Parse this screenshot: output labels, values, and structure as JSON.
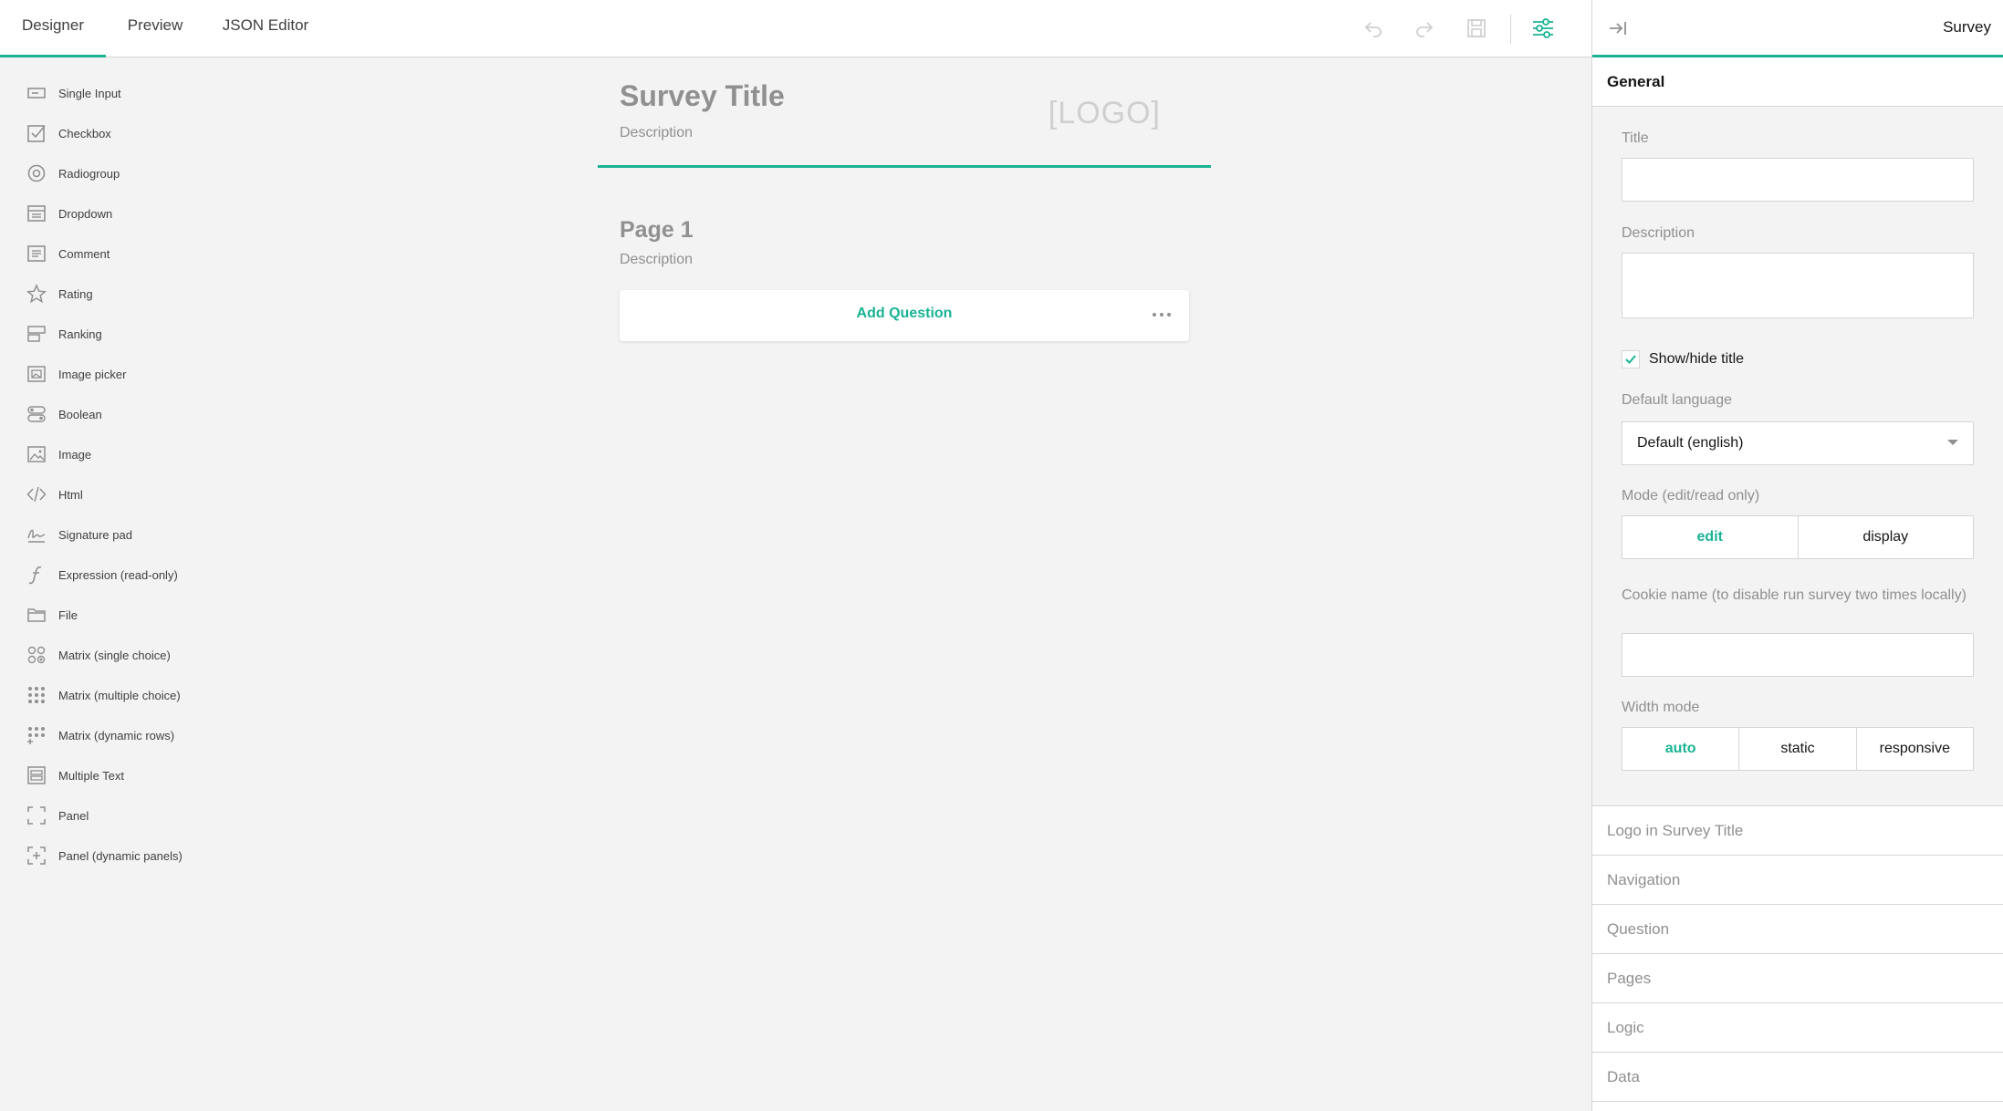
{
  "tabs": [
    {
      "label": "Designer"
    },
    {
      "label": "Preview"
    },
    {
      "label": "JSON Editor"
    }
  ],
  "toolbar_icons": [
    "undo-icon",
    "redo-icon",
    "save-icon",
    "settings-icon"
  ],
  "accent_color": "#19b394",
  "toolbox": {
    "items": [
      {
        "label": "Single Input",
        "icon": "single-input-icon"
      },
      {
        "label": "Checkbox",
        "icon": "checkbox-icon"
      },
      {
        "label": "Radiogroup",
        "icon": "radiogroup-icon"
      },
      {
        "label": "Dropdown",
        "icon": "dropdown-icon"
      },
      {
        "label": "Comment",
        "icon": "comment-icon"
      },
      {
        "label": "Rating",
        "icon": "rating-star-icon"
      },
      {
        "label": "Ranking",
        "icon": "ranking-icon"
      },
      {
        "label": "Image picker",
        "icon": "image-picker-icon"
      },
      {
        "label": "Boolean",
        "icon": "boolean-icon"
      },
      {
        "label": "Image",
        "icon": "image-icon"
      },
      {
        "label": "Html",
        "icon": "html-code-icon"
      },
      {
        "label": "Signature pad",
        "icon": "signature-icon"
      },
      {
        "label": "Expression (read-only)",
        "icon": "expression-icon"
      },
      {
        "label": "File",
        "icon": "folder-icon"
      },
      {
        "label": "Matrix (single choice)",
        "icon": "matrix-single-icon"
      },
      {
        "label": "Matrix (multiple choice)",
        "icon": "matrix-multiple-icon"
      },
      {
        "label": "Matrix (dynamic rows)",
        "icon": "matrix-dynamic-icon"
      },
      {
        "label": "Multiple Text",
        "icon": "multiple-text-icon"
      },
      {
        "label": "Panel",
        "icon": "panel-icon"
      },
      {
        "label": "Panel (dynamic panels)",
        "icon": "panel-dynamic-icon"
      }
    ]
  },
  "survey": {
    "title": "Survey Title",
    "description": "Description",
    "logo_placeholder": "[LOGO]",
    "page": {
      "title": "Page 1",
      "description": "Description",
      "add_question_label": "Add Question"
    }
  },
  "properties": {
    "object_name": "Survey",
    "general_label": "General",
    "title_label": "Title",
    "title_value": "",
    "description_label": "Description",
    "description_value": "",
    "show_title_label": "Show/hide title",
    "show_title_checked": true,
    "default_language_label": "Default language",
    "default_language_value": "Default (english)",
    "mode_label": "Mode (edit/read only)",
    "mode_options": [
      "edit",
      "display"
    ],
    "mode_selected": "edit",
    "cookie_label": "Cookie name (to disable run survey two times locally)",
    "cookie_value": "",
    "width_mode_label": "Width mode",
    "width_mode_options": [
      "auto",
      "static",
      "responsive"
    ],
    "width_mode_selected": "auto",
    "sections": [
      "Logo in Survey Title",
      "Navigation",
      "Question",
      "Pages",
      "Logic",
      "Data"
    ]
  }
}
